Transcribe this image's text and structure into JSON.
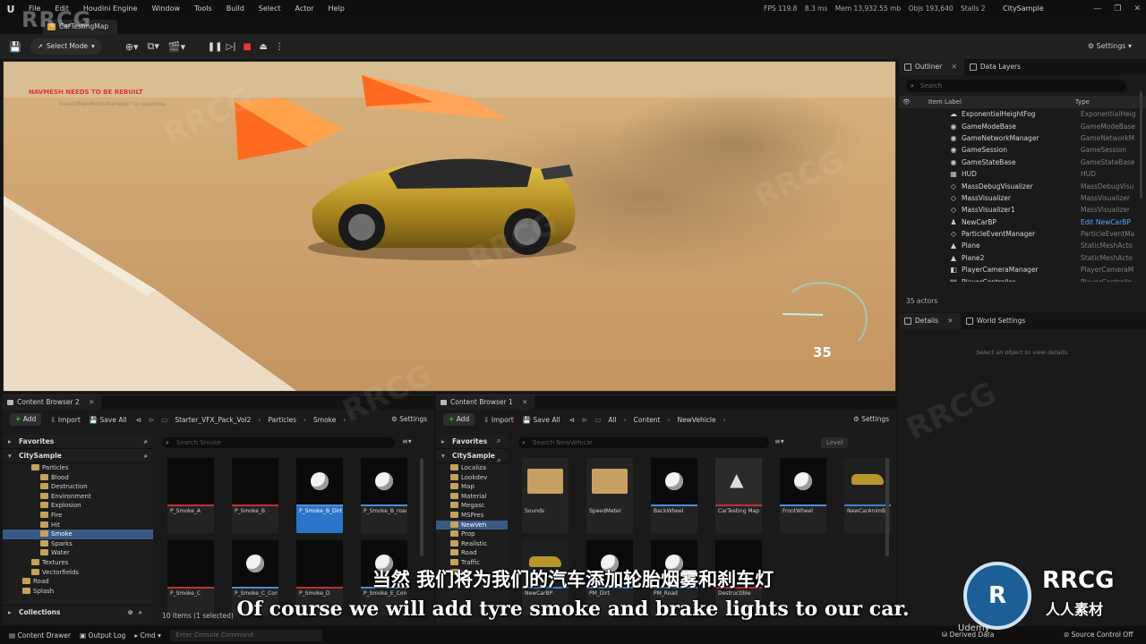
{
  "app": {
    "logo": "U",
    "menu": [
      "File",
      "Edit",
      "Houdini Engine",
      "Window",
      "Tools",
      "Build",
      "Select",
      "Actor",
      "Help"
    ],
    "stats": {
      "fps": "FPS 119.8",
      "ms": "8.3 ms",
      "mem": "Mem 13,932.55 mb",
      "objs": "Objs 193,640",
      "stalls": "Stalls 2"
    },
    "project": "CitySample",
    "map_tab": "CarTestingMap"
  },
  "toolbar": {
    "mode": "Select Mode",
    "settings": "Settings"
  },
  "viewport": {
    "warning": "NAVMESH NEEDS TO BE REBUILT",
    "sub_warning": "InvalidNavMeshManager to suppress",
    "speed": "35"
  },
  "outliner": {
    "tab": "Outliner",
    "tab2": "Data Layers",
    "search_placeholder": "Search",
    "col_label": "Item Label",
    "col_type": "Type",
    "rows": [
      {
        "label": "ExponentialHeightFog",
        "type": "ExponentialHeig",
        "icon": "fog-icon"
      },
      {
        "label": "GameModeBase",
        "type": "GameModeBase",
        "icon": "game-icon"
      },
      {
        "label": "GameNetworkManager",
        "type": "GameNetworkM",
        "icon": "game-icon"
      },
      {
        "label": "GameSession",
        "type": "GameSession",
        "icon": "game-icon"
      },
      {
        "label": "GameStateBase",
        "type": "GameStateBase",
        "icon": "game-icon"
      },
      {
        "label": "HUD",
        "type": "HUD",
        "icon": "hud-icon"
      },
      {
        "label": "MassDebugVisualizer",
        "type": "MassDebugVisu",
        "icon": "actor-icon"
      },
      {
        "label": "MassVisualizer",
        "type": "MassVisualizer",
        "icon": "actor-icon"
      },
      {
        "label": "MassVisualizer1",
        "type": "MassVisualizer",
        "icon": "actor-icon"
      },
      {
        "label": "NewCarBP",
        "type": "Edit NewCarBP",
        "icon": "pawn-icon"
      },
      {
        "label": "ParticleEventManager",
        "type": "ParticleEventMa",
        "icon": "actor-icon"
      },
      {
        "label": "Plane",
        "type": "StaticMeshActo",
        "icon": "mesh-icon"
      },
      {
        "label": "Plane2",
        "type": "StaticMeshActo",
        "icon": "mesh-icon"
      },
      {
        "label": "PlayerCameraManager",
        "type": "PlayerCameraM",
        "icon": "camera-icon"
      },
      {
        "label": "PlayerController",
        "type": "PlayerControlle",
        "icon": "controller-icon"
      }
    ],
    "actor_count": "35 actors"
  },
  "details": {
    "tab": "Details",
    "tab2": "World Settings",
    "empty": "Select an object to view details."
  },
  "cb2": {
    "tab": "Content Browser 2",
    "add": "Add",
    "import": "Import",
    "save_all": "Save All",
    "crumbs": [
      "Starter_VFX_Pack_Vol2",
      "Particles",
      "Smoke"
    ],
    "settings": "Settings",
    "favorites": "Favorites",
    "root": "CitySample",
    "search_placeholder": "Search Smoke",
    "tree": [
      {
        "label": "Particles",
        "indent": 1
      },
      {
        "label": "Blood",
        "indent": 2
      },
      {
        "label": "Destruction",
        "indent": 2
      },
      {
        "label": "Environment",
        "indent": 2
      },
      {
        "label": "Explosion",
        "indent": 2
      },
      {
        "label": "Fire",
        "indent": 2
      },
      {
        "label": "Hit",
        "indent": 2
      },
      {
        "label": "Smoke",
        "indent": 2,
        "selected": true
      },
      {
        "label": "Sparks",
        "indent": 2
      },
      {
        "label": "Water",
        "indent": 2
      },
      {
        "label": "Textures",
        "indent": 1
      },
      {
        "label": "Vectorfields",
        "indent": 1
      },
      {
        "label": "Road",
        "indent": 0
      },
      {
        "label": "Splash",
        "indent": 0
      }
    ],
    "collections": "Collections",
    "assets": [
      {
        "label": "P_Smoke_A",
        "thumb": "dark"
      },
      {
        "label": "P_Smoke_B",
        "thumb": "dark"
      },
      {
        "label": "P_Smoke_B_Dirt",
        "thumb": "sphere",
        "selected": true
      },
      {
        "label": "P_Smoke_B_road",
        "thumb": "sphere"
      },
      {
        "label": "P_Smoke_C",
        "thumb": "dark"
      },
      {
        "label": "P_Smoke_C_Converted",
        "thumb": "sphere"
      },
      {
        "label": "P_Smoke_D",
        "thumb": "dark"
      },
      {
        "label": "P_Smoke_E_Converted",
        "thumb": "sphere"
      }
    ],
    "count": "10 items (1 selected)"
  },
  "cb1": {
    "tab": "Content Browser 1",
    "add": "Add",
    "import": "Import",
    "save_all": "Save All",
    "crumbs": [
      "All",
      "Content",
      "NewVehicle"
    ],
    "settings": "Settings",
    "favorites": "Favorites",
    "root": "CitySample",
    "search_placeholder": "Search NewVehicle",
    "level_btn": "Level",
    "tree": [
      {
        "label": "Localiza"
      },
      {
        "label": "Lookdev"
      },
      {
        "label": "Map"
      },
      {
        "label": "Material"
      },
      {
        "label": "Megasc"
      },
      {
        "label": "MSPres"
      },
      {
        "label": "NewVeh",
        "selected": true
      },
      {
        "label": "Prop"
      },
      {
        "label": "Realistic"
      },
      {
        "label": "Road"
      },
      {
        "label": "Traffic"
      },
      {
        "label": "UI"
      }
    ],
    "assets": [
      {
        "label": "Sounds",
        "thumb": "folder"
      },
      {
        "label": "SpeedMeter",
        "thumb": "folder"
      },
      {
        "label": "BackWheel",
        "thumb": "sphere"
      },
      {
        "label": "CarTesting Map",
        "thumb": "map"
      },
      {
        "label": "FrontWheel",
        "thumb": "sphere"
      },
      {
        "label": "NewCarAnimBP",
        "thumb": "car"
      },
      {
        "label": "NewCarBP",
        "thumb": "car"
      },
      {
        "label": "PM_Dirt",
        "thumb": "sphere"
      },
      {
        "label": "PM_Road",
        "thumb": "sphere"
      },
      {
        "label": "Destructible",
        "thumb": "dark"
      }
    ]
  },
  "statusbar": {
    "content_drawer": "Content Drawer",
    "output_log": "Output Log",
    "cmd": "Cmd",
    "console_placeholder": "Enter Console Command",
    "derived_data": "Derived Data",
    "source_control": "Source Control Off"
  },
  "overlay": {
    "subtitle_cn": "当然 我们将为我们的汽车添加轮胎烟雾和刹车灯",
    "subtitle_en": "Of course we will add tyre smoke and brake lights to our car.",
    "watermark_tl": "RRCG",
    "brand": "RRCG",
    "brand_sub": "人人素材",
    "udemy": "Udemy",
    "watermark": "RRCG"
  },
  "colors": {
    "accent": "#2a74c9",
    "sand": "#c9a574",
    "car": "#b8962a",
    "ramp": "#ff6a21",
    "stop": "#e83a3a"
  }
}
